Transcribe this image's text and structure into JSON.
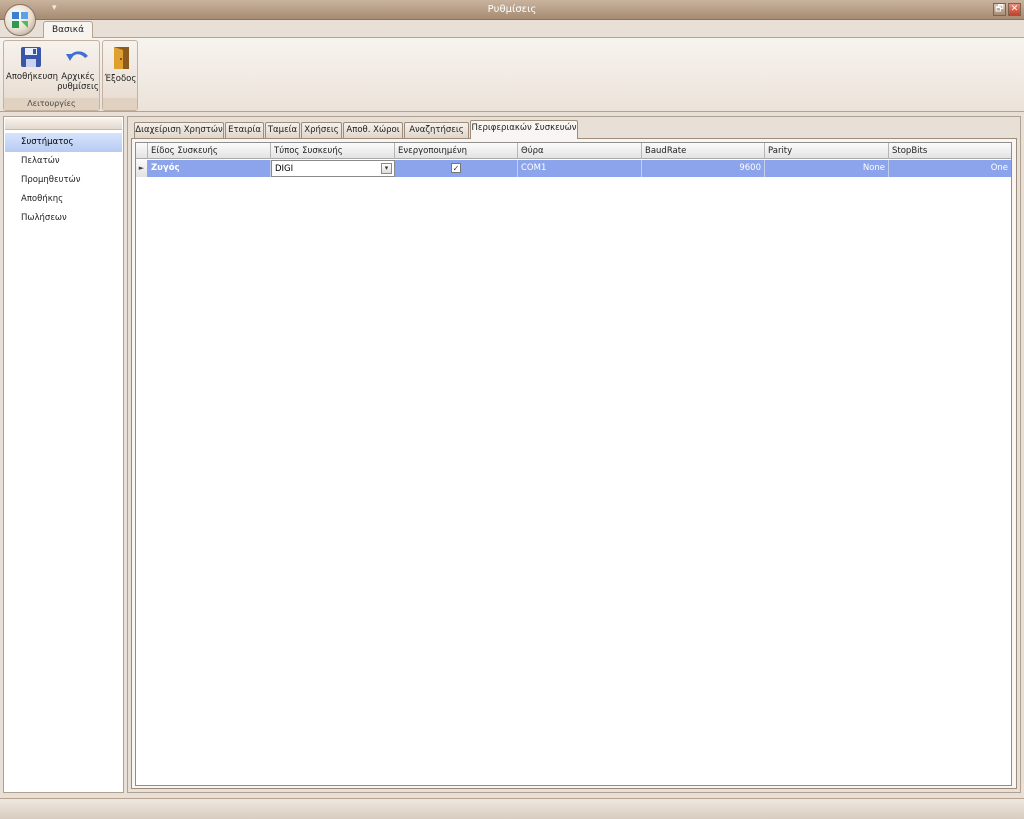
{
  "window": {
    "title": "Ρυθμίσεις",
    "restore_glyph": "🗗",
    "close_glyph": "✕",
    "qat_glyph": "▾"
  },
  "ribbon": {
    "tab": "Βασικά",
    "groups": [
      {
        "label": "Λειτουργίες",
        "buttons": [
          {
            "label": "Αποθήκευση",
            "icon": "save-icon"
          },
          {
            "label": "Αρχικές ρυθμίσεις",
            "icon": "undo-icon"
          }
        ]
      },
      {
        "label": "",
        "buttons": [
          {
            "label": "Έξοδος",
            "icon": "exit-door-icon"
          }
        ]
      }
    ]
  },
  "sidebar": {
    "items": [
      {
        "label": "Συστήματος",
        "selected": true
      },
      {
        "label": "Πελατών",
        "selected": false
      },
      {
        "label": "Προμηθευτών",
        "selected": false
      },
      {
        "label": "Αποθήκης",
        "selected": false
      },
      {
        "label": "Πωλήσεων",
        "selected": false
      }
    ]
  },
  "tabs": [
    {
      "label": "Διαχείριση Χρηστών",
      "active": false
    },
    {
      "label": "Εταιρία",
      "active": false
    },
    {
      "label": "Ταμεία",
      "active": false
    },
    {
      "label": "Χρήσεις",
      "active": false
    },
    {
      "label": "Αποθ. Χώροι",
      "active": false
    },
    {
      "label": "Αναζητήσεις",
      "active": false
    },
    {
      "label": "Περιφεριακών Συσκευών",
      "active": true
    }
  ],
  "grid": {
    "columns": [
      "Είδος Συσκευής",
      "Τύπος Συσκευής",
      "Ενεργοποιημένη",
      "Θύρα",
      "BaudRate",
      "Parity",
      "StopBits"
    ],
    "rows": [
      {
        "device_kind": "Ζυγός",
        "device_type": "DIGI",
        "enabled": "✓",
        "port": "COM1",
        "baud_rate": "9600",
        "parity": "None",
        "stop_bits": "One"
      }
    ],
    "row_indicator": "►",
    "dropdown_glyph": "▾"
  },
  "colors": {
    "selection": "#8ca4ec",
    "chrome": "#a78b72",
    "close": "#c2412b"
  }
}
